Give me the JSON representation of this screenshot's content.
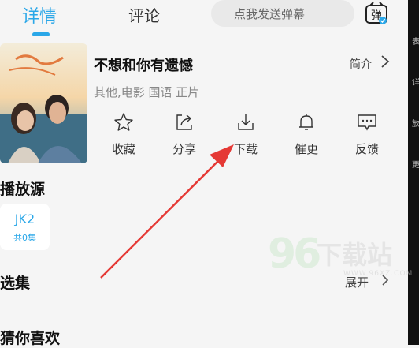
{
  "tabs": [
    {
      "label": "详情",
      "active": true
    },
    {
      "label": "评论",
      "active": false
    }
  ],
  "danmu": {
    "placeholder": "点我发送弹幕",
    "icon_char": "弹"
  },
  "right_strip": [
    "表",
    "详",
    "放",
    "更"
  ],
  "movie": {
    "title": "不想和你有遗憾",
    "intro_label": "简介",
    "meta": "其他,电影 国语 正片"
  },
  "actions": [
    {
      "label": "收藏",
      "icon": "star-icon"
    },
    {
      "label": "分享",
      "icon": "share-icon"
    },
    {
      "label": "下载",
      "icon": "download-icon"
    },
    {
      "label": "催更",
      "icon": "bell-icon"
    },
    {
      "label": "反馈",
      "icon": "feedback-icon"
    }
  ],
  "play_source": {
    "heading": "播放源",
    "name": "JK2",
    "count": "共0集"
  },
  "episodes": {
    "heading": "选集",
    "expand_label": "展开"
  },
  "recommend": {
    "heading": "猜你喜欢"
  },
  "watermark": {
    "number": "96",
    "text": "下载站",
    "url": "WWW.96XZ.COM"
  },
  "colors": {
    "accent": "#2aa7e8",
    "arrow": "#e53935",
    "background": "#f5f5f5"
  }
}
